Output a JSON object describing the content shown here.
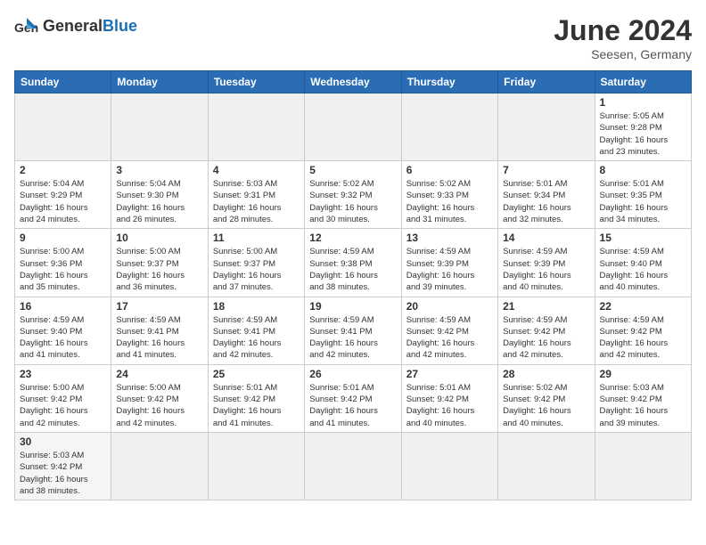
{
  "header": {
    "logo_general": "General",
    "logo_blue": "Blue",
    "title": "June 2024",
    "location": "Seesen, Germany"
  },
  "weekdays": [
    "Sunday",
    "Monday",
    "Tuesday",
    "Wednesday",
    "Thursday",
    "Friday",
    "Saturday"
  ],
  "days": {
    "d1": {
      "num": "1",
      "info": "Sunrise: 5:05 AM\nSunset: 9:28 PM\nDaylight: 16 hours\nand 23 minutes."
    },
    "d2": {
      "num": "2",
      "info": "Sunrise: 5:04 AM\nSunset: 9:29 PM\nDaylight: 16 hours\nand 24 minutes."
    },
    "d3": {
      "num": "3",
      "info": "Sunrise: 5:04 AM\nSunset: 9:30 PM\nDaylight: 16 hours\nand 26 minutes."
    },
    "d4": {
      "num": "4",
      "info": "Sunrise: 5:03 AM\nSunset: 9:31 PM\nDaylight: 16 hours\nand 28 minutes."
    },
    "d5": {
      "num": "5",
      "info": "Sunrise: 5:02 AM\nSunset: 9:32 PM\nDaylight: 16 hours\nand 30 minutes."
    },
    "d6": {
      "num": "6",
      "info": "Sunrise: 5:02 AM\nSunset: 9:33 PM\nDaylight: 16 hours\nand 31 minutes."
    },
    "d7": {
      "num": "7",
      "info": "Sunrise: 5:01 AM\nSunset: 9:34 PM\nDaylight: 16 hours\nand 32 minutes."
    },
    "d8": {
      "num": "8",
      "info": "Sunrise: 5:01 AM\nSunset: 9:35 PM\nDaylight: 16 hours\nand 34 minutes."
    },
    "d9": {
      "num": "9",
      "info": "Sunrise: 5:00 AM\nSunset: 9:36 PM\nDaylight: 16 hours\nand 35 minutes."
    },
    "d10": {
      "num": "10",
      "info": "Sunrise: 5:00 AM\nSunset: 9:37 PM\nDaylight: 16 hours\nand 36 minutes."
    },
    "d11": {
      "num": "11",
      "info": "Sunrise: 5:00 AM\nSunset: 9:37 PM\nDaylight: 16 hours\nand 37 minutes."
    },
    "d12": {
      "num": "12",
      "info": "Sunrise: 4:59 AM\nSunset: 9:38 PM\nDaylight: 16 hours\nand 38 minutes."
    },
    "d13": {
      "num": "13",
      "info": "Sunrise: 4:59 AM\nSunset: 9:39 PM\nDaylight: 16 hours\nand 39 minutes."
    },
    "d14": {
      "num": "14",
      "info": "Sunrise: 4:59 AM\nSunset: 9:39 PM\nDaylight: 16 hours\nand 40 minutes."
    },
    "d15": {
      "num": "15",
      "info": "Sunrise: 4:59 AM\nSunset: 9:40 PM\nDaylight: 16 hours\nand 40 minutes."
    },
    "d16": {
      "num": "16",
      "info": "Sunrise: 4:59 AM\nSunset: 9:40 PM\nDaylight: 16 hours\nand 41 minutes."
    },
    "d17": {
      "num": "17",
      "info": "Sunrise: 4:59 AM\nSunset: 9:41 PM\nDaylight: 16 hours\nand 41 minutes."
    },
    "d18": {
      "num": "18",
      "info": "Sunrise: 4:59 AM\nSunset: 9:41 PM\nDaylight: 16 hours\nand 42 minutes."
    },
    "d19": {
      "num": "19",
      "info": "Sunrise: 4:59 AM\nSunset: 9:41 PM\nDaylight: 16 hours\nand 42 minutes."
    },
    "d20": {
      "num": "20",
      "info": "Sunrise: 4:59 AM\nSunset: 9:42 PM\nDaylight: 16 hours\nand 42 minutes."
    },
    "d21": {
      "num": "21",
      "info": "Sunrise: 4:59 AM\nSunset: 9:42 PM\nDaylight: 16 hours\nand 42 minutes."
    },
    "d22": {
      "num": "22",
      "info": "Sunrise: 4:59 AM\nSunset: 9:42 PM\nDaylight: 16 hours\nand 42 minutes."
    },
    "d23": {
      "num": "23",
      "info": "Sunrise: 5:00 AM\nSunset: 9:42 PM\nDaylight: 16 hours\nand 42 minutes."
    },
    "d24": {
      "num": "24",
      "info": "Sunrise: 5:00 AM\nSunset: 9:42 PM\nDaylight: 16 hours\nand 42 minutes."
    },
    "d25": {
      "num": "25",
      "info": "Sunrise: 5:01 AM\nSunset: 9:42 PM\nDaylight: 16 hours\nand 41 minutes."
    },
    "d26": {
      "num": "26",
      "info": "Sunrise: 5:01 AM\nSunset: 9:42 PM\nDaylight: 16 hours\nand 41 minutes."
    },
    "d27": {
      "num": "27",
      "info": "Sunrise: 5:01 AM\nSunset: 9:42 PM\nDaylight: 16 hours\nand 40 minutes."
    },
    "d28": {
      "num": "28",
      "info": "Sunrise: 5:02 AM\nSunset: 9:42 PM\nDaylight: 16 hours\nand 40 minutes."
    },
    "d29": {
      "num": "29",
      "info": "Sunrise: 5:03 AM\nSunset: 9:42 PM\nDaylight: 16 hours\nand 39 minutes."
    },
    "d30": {
      "num": "30",
      "info": "Sunrise: 5:03 AM\nSunset: 9:42 PM\nDaylight: 16 hours\nand 38 minutes."
    }
  }
}
